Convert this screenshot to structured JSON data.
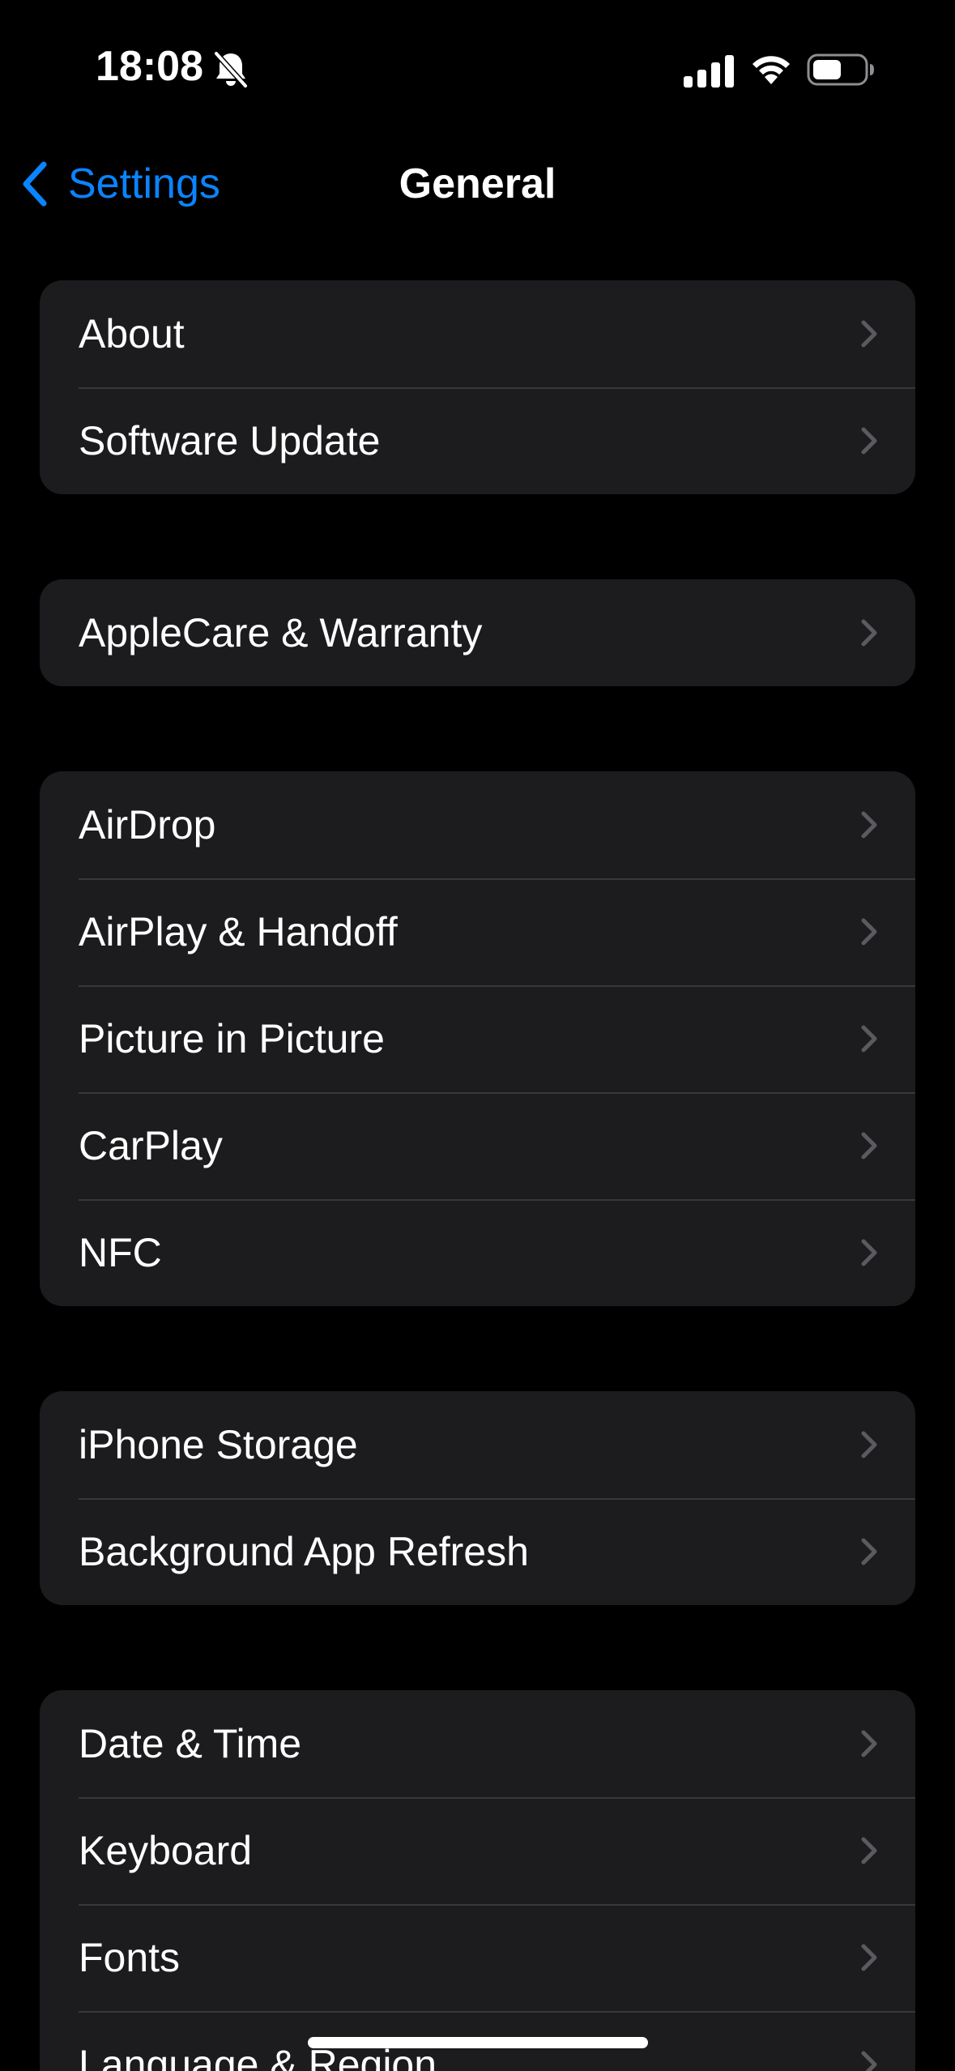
{
  "status_bar": {
    "time": "18:08",
    "icons": [
      "bell-slash-icon",
      "cellular-signal-icon",
      "wifi-icon",
      "battery-icon"
    ]
  },
  "nav": {
    "back_label": "Settings",
    "title": "General"
  },
  "groups": [
    {
      "rows": [
        "About",
        "Software Update"
      ]
    },
    {
      "rows": [
        "AppleCare & Warranty"
      ]
    },
    {
      "rows": [
        "AirDrop",
        "AirPlay & Handoff",
        "Picture in Picture",
        "CarPlay",
        "NFC"
      ]
    },
    {
      "rows": [
        "iPhone Storage",
        "Background App Refresh"
      ]
    },
    {
      "rows": [
        "Date & Time",
        "Keyboard",
        "Fonts",
        "Language & Region"
      ]
    }
  ],
  "colors": {
    "background": "#000000",
    "cell": "#1c1c1e",
    "separator": "#38383a",
    "accent": "#0a84ff",
    "chevron": "#5a5a5f"
  }
}
